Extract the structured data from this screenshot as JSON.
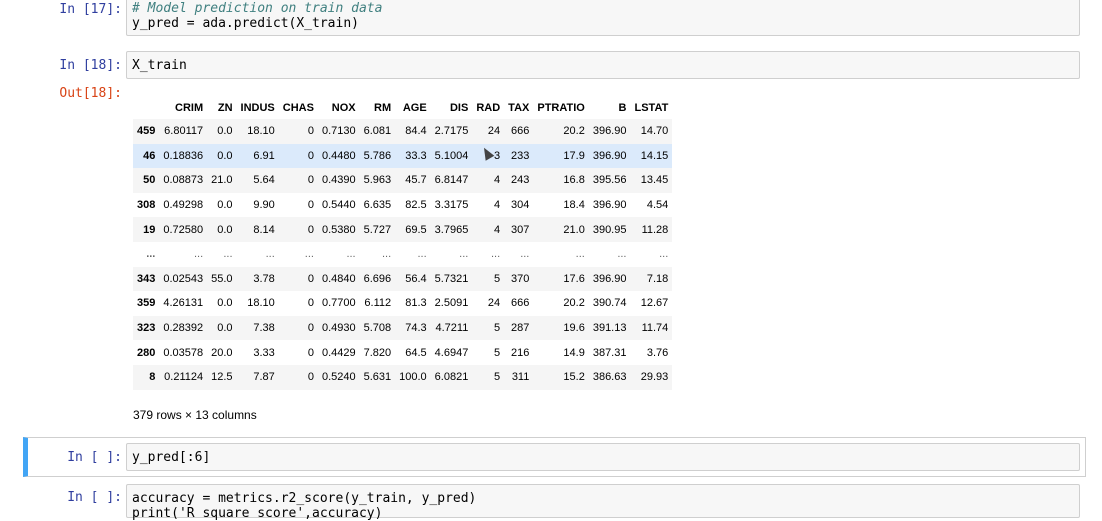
{
  "cells": [
    {
      "prompt": "In [17]:",
      "lines": [
        "# Model prediction on train data",
        "y_pred = ada.predict(X_train)"
      ]
    },
    {
      "prompt": "In [18]:",
      "lines": [
        "X_train"
      ]
    },
    {
      "out_prompt": "Out[18]:"
    },
    {
      "prompt": "In [ ]:",
      "lines": [
        "y_pred[:6]"
      ]
    },
    {
      "prompt": "In [ ]:",
      "lines": [
        "accuracy = metrics.r2_score(y_train, y_pred)",
        "print('R square score',accuracy)"
      ]
    }
  ],
  "dataframe": {
    "columns": [
      "",
      "CRIM",
      "ZN",
      "INDUS",
      "CHAS",
      "NOX",
      "RM",
      "AGE",
      "DIS",
      "RAD",
      "TAX",
      "PTRATIO",
      "B",
      "LSTAT"
    ],
    "rows": [
      [
        "459",
        "6.80117",
        "0.0",
        "18.10",
        "0",
        "0.7130",
        "6.081",
        "84.4",
        "2.7175",
        "24",
        "666",
        "20.2",
        "396.90",
        "14.70"
      ],
      [
        "46",
        "0.18836",
        "0.0",
        "6.91",
        "0",
        "0.4480",
        "5.786",
        "33.3",
        "5.1004",
        "3",
        "233",
        "17.9",
        "396.90",
        "14.15"
      ],
      [
        "50",
        "0.08873",
        "21.0",
        "5.64",
        "0",
        "0.4390",
        "5.963",
        "45.7",
        "6.8147",
        "4",
        "243",
        "16.8",
        "395.56",
        "13.45"
      ],
      [
        "308",
        "0.49298",
        "0.0",
        "9.90",
        "0",
        "0.5440",
        "6.635",
        "82.5",
        "3.3175",
        "4",
        "304",
        "18.4",
        "396.90",
        "4.54"
      ],
      [
        "19",
        "0.72580",
        "0.0",
        "8.14",
        "0",
        "0.5380",
        "5.727",
        "69.5",
        "3.7965",
        "4",
        "307",
        "21.0",
        "390.95",
        "11.28"
      ],
      [
        "...",
        "...",
        "...",
        "...",
        "...",
        "...",
        "...",
        "...",
        "...",
        "...",
        "...",
        "...",
        "...",
        "..."
      ],
      [
        "343",
        "0.02543",
        "55.0",
        "3.78",
        "0",
        "0.4840",
        "6.696",
        "56.4",
        "5.7321",
        "5",
        "370",
        "17.6",
        "396.90",
        "7.18"
      ],
      [
        "359",
        "4.26131",
        "0.0",
        "18.10",
        "0",
        "0.7700",
        "6.112",
        "81.3",
        "2.5091",
        "24",
        "666",
        "20.2",
        "390.74",
        "12.67"
      ],
      [
        "323",
        "0.28392",
        "0.0",
        "7.38",
        "0",
        "0.4930",
        "5.708",
        "74.3",
        "4.7211",
        "5",
        "287",
        "19.6",
        "391.13",
        "11.74"
      ],
      [
        "280",
        "0.03578",
        "20.0",
        "3.33",
        "0",
        "0.4429",
        "7.820",
        "64.5",
        "4.6947",
        "5",
        "216",
        "14.9",
        "387.31",
        "3.76"
      ],
      [
        "8",
        "0.21124",
        "12.5",
        "7.87",
        "0",
        "0.5240",
        "5.631",
        "100.0",
        "6.0821",
        "5",
        "311",
        "15.2",
        "386.63",
        "29.93"
      ]
    ],
    "shape_note": "379 rows × 13 columns"
  }
}
